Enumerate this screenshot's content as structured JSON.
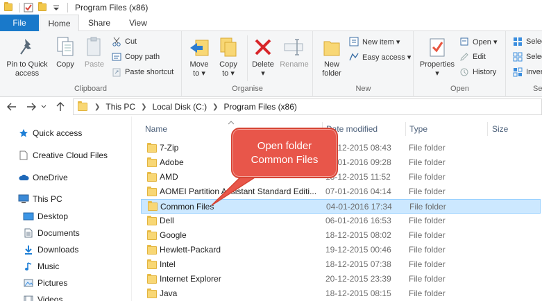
{
  "window": {
    "title": "Program Files (x86)"
  },
  "tabs": {
    "file": "File",
    "home": "Home",
    "share": "Share",
    "view": "View"
  },
  "ribbon": {
    "clipboard": {
      "label": "Clipboard",
      "pin": "Pin to Quick access",
      "pin_line1": "Pin to Quick",
      "pin_line2": "access",
      "copy": "Copy",
      "paste": "Paste",
      "cut": "Cut",
      "copy_path": "Copy path",
      "paste_shortcut": "Paste shortcut"
    },
    "organise": {
      "label": "Organise",
      "move_to_line1": "Move",
      "move_to_line2": "to ▾",
      "copy_to_line1": "Copy",
      "copy_to_line2": "to ▾",
      "delete_line1": "Delete",
      "delete_line2": "▾",
      "rename": "Rename"
    },
    "new": {
      "label": "New",
      "new_folder_line1": "New",
      "new_folder_line2": "folder",
      "new_item": "New item ▾",
      "easy_access": "Easy access ▾"
    },
    "open": {
      "label": "Open",
      "properties_line1": "Properties",
      "properties_line2": "▾",
      "open": "Open ▾",
      "edit": "Edit",
      "history": "History"
    },
    "select": {
      "label": "Se",
      "select_all": "Selec",
      "select_none": "Selec",
      "invert": "Inver"
    }
  },
  "address": {
    "crumbs": [
      "This PC",
      "Local Disk (C:)",
      "Program Files (x86)"
    ]
  },
  "navpane": {
    "items": [
      {
        "label": "Quick access",
        "icon": "star-icon"
      },
      {
        "label": "Creative Cloud Files",
        "icon": "document-icon"
      },
      {
        "label": "OneDrive",
        "icon": "cloud-icon"
      },
      {
        "label": "This PC",
        "icon": "computer-icon"
      },
      {
        "label": "Desktop",
        "icon": "desktop-icon"
      },
      {
        "label": "Documents",
        "icon": "documents-icon"
      },
      {
        "label": "Downloads",
        "icon": "download-icon"
      },
      {
        "label": "Music",
        "icon": "music-icon"
      },
      {
        "label": "Pictures",
        "icon": "pictures-icon"
      },
      {
        "label": "Videos",
        "icon": "videos-icon"
      }
    ]
  },
  "filelist": {
    "headers": {
      "name": "Name",
      "date": "Date modified",
      "type": "Type",
      "size": "Size"
    },
    "rows": [
      {
        "name": "7-Zip",
        "date": "18-12-2015 08:43",
        "type": "File folder"
      },
      {
        "name": "Adobe",
        "date": "04-01-2016 09:28",
        "type": "File folder"
      },
      {
        "name": "AMD",
        "date": "18-12-2015 11:52",
        "type": "File folder"
      },
      {
        "name": "AOMEI Partition Assistant Standard Editi...",
        "date": "07-01-2016 04:14",
        "type": "File folder"
      },
      {
        "name": "Common Files",
        "date": "04-01-2016 17:34",
        "type": "File folder",
        "selected": true
      },
      {
        "name": "Dell",
        "date": "06-01-2016 16:53",
        "type": "File folder"
      },
      {
        "name": "Google",
        "date": "18-12-2015 08:02",
        "type": "File folder"
      },
      {
        "name": "Hewlett-Packard",
        "date": "19-12-2015 00:46",
        "type": "File folder"
      },
      {
        "name": "Intel",
        "date": "18-12-2015 07:38",
        "type": "File folder"
      },
      {
        "name": "Internet Explorer",
        "date": "20-12-2015 23:39",
        "type": "File folder"
      },
      {
        "name": "Java",
        "date": "18-12-2015 08:15",
        "type": "File folder"
      }
    ]
  },
  "callout": {
    "line1": "Open folder",
    "line2": "Common Files"
  },
  "colors": {
    "accent": "#1979ca",
    "selection": "#cce8ff",
    "callout": "#e8564a",
    "folder": "#f8d775"
  }
}
